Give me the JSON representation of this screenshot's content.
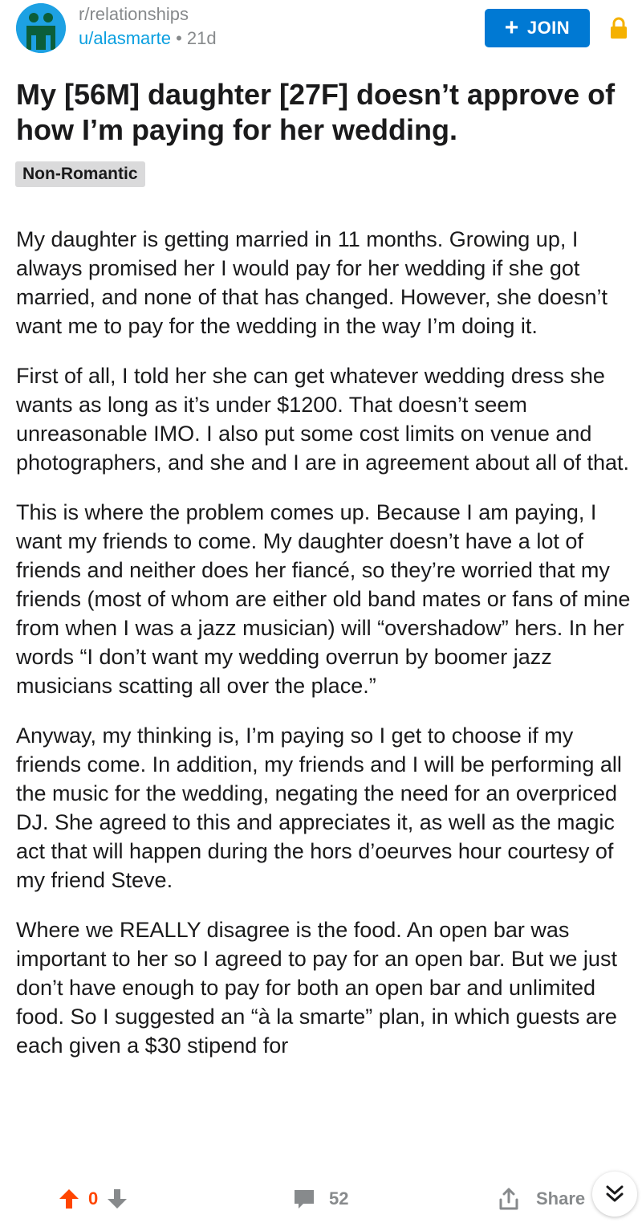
{
  "post": {
    "subreddit": "r/relationships",
    "author": "u/alasmarte",
    "age": "21d",
    "separator": "•",
    "title": "My [56M] daughter [27F] doesn’t approve of how I’m paying for her wedding.",
    "flair": "Non-Romantic",
    "body": [
      "My daughter is getting married in 11 months.  Growing up, I always promised her I would pay for her wedding if she got married, and none of that has changed. However, she doesn’t want me to pay for the wedding in the way I’m doing it.",
      "First of all, I told her she can get whatever wedding dress she wants as long as it’s under $1200. That doesn’t seem unreasonable IMO. I also put some cost limits on venue and photographers, and she and I are in agreement about all of that.",
      "This is where the problem comes up. Because I am paying, I want my friends to come. My daughter doesn’t have a lot of friends and neither does her fiancé, so they’re worried that my friends (most of whom are either old band mates or fans of mine from when I was a jazz musician) will “overshadow” hers. In her words “I don’t want my wedding overrun by boomer jazz musicians scatting all over the place.”",
      "Anyway, my thinking is, I’m paying so I get to choose if my friends come. In addition, my friends and I will be performing all the music for the wedding, negating the need for an overpriced DJ. She agreed to this and appreciates it, as well as the magic act that will happen during the hors d’oeurves hour courtesy of my friend Steve.",
      "Where we REALLY disagree is the food. An open bar was important to her so I agreed to pay for an open bar. But we just don’t have enough to pay for both an open bar and unlimited food. So I suggested an “à la smarte” plan, in which guests are each given a $30 stipend for"
    ]
  },
  "header": {
    "join_label": "JOIN"
  },
  "footer": {
    "score": "0",
    "comments": "52",
    "share_label": "Share"
  },
  "colors": {
    "upvote": "#ff4500",
    "join": "#0079d3",
    "lock": "#f5b100",
    "avatar": "#1da1e3"
  }
}
